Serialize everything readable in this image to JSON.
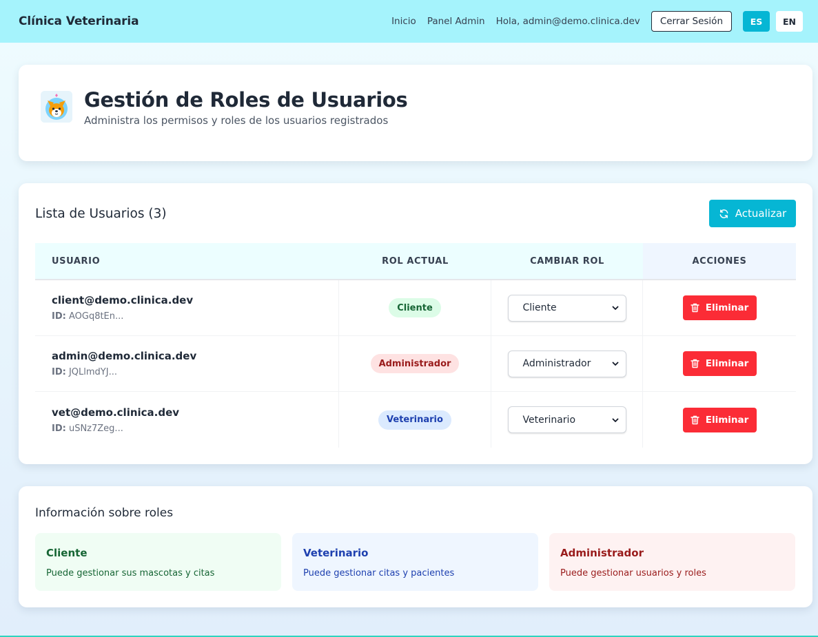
{
  "nav": {
    "brand": "Clínica Veterinaria",
    "links": [
      "Inicio",
      "Panel Admin"
    ],
    "greeting": "Hola, admin@demo.clinica.dev",
    "logout_label": "Cerrar Sesión",
    "lang_es": "ES",
    "lang_en": "EN",
    "active_lang": "ES"
  },
  "header": {
    "avatar_icon": "corgi-dog-avatar",
    "title": "Gestión de Roles de Usuarios",
    "subtitle": "Administra los permisos y roles de los usuarios registrados"
  },
  "users": {
    "title": "Lista de Usuarios (3)",
    "refresh_label": "Actualizar",
    "refresh_icon": "refresh-icon",
    "columns": [
      "USUARIO",
      "ROL ACTUAL",
      "CAMBIAR ROL",
      "ACCIONES"
    ],
    "id_label": "ID:",
    "rows": [
      {
        "email": "client@demo.clinica.dev",
        "id": "AOGq8tEn...",
        "role": "Cliente",
        "role_select": "Cliente",
        "delete_label": "Eliminar"
      },
      {
        "email": "admin@demo.clinica.dev",
        "id": "JQLlmdYJ...",
        "role": "Administrador",
        "role_select": "Administrador",
        "delete_label": "Eliminar"
      },
      {
        "email": "vet@demo.clinica.dev",
        "id": "uSNz7Zeg...",
        "role": "Veterinario",
        "role_select": "Veterinario",
        "delete_label": "Eliminar"
      }
    ]
  },
  "info": {
    "title": "Información sobre roles",
    "roles": [
      {
        "name": "Cliente",
        "desc": "Puede gestionar sus mascotas y citas"
      },
      {
        "name": "Veterinario",
        "desc": "Puede gestionar citas y pacientes"
      },
      {
        "name": "Administrador",
        "desc": "Puede gestionar usuarios y roles"
      }
    ]
  },
  "colors": {
    "navbar": "#a5f3fc",
    "accent": "#06b6d4",
    "danger": "#fb2c36",
    "cliente": "#166534",
    "veterinario": "#1e40af",
    "administrador": "#991b1b"
  }
}
